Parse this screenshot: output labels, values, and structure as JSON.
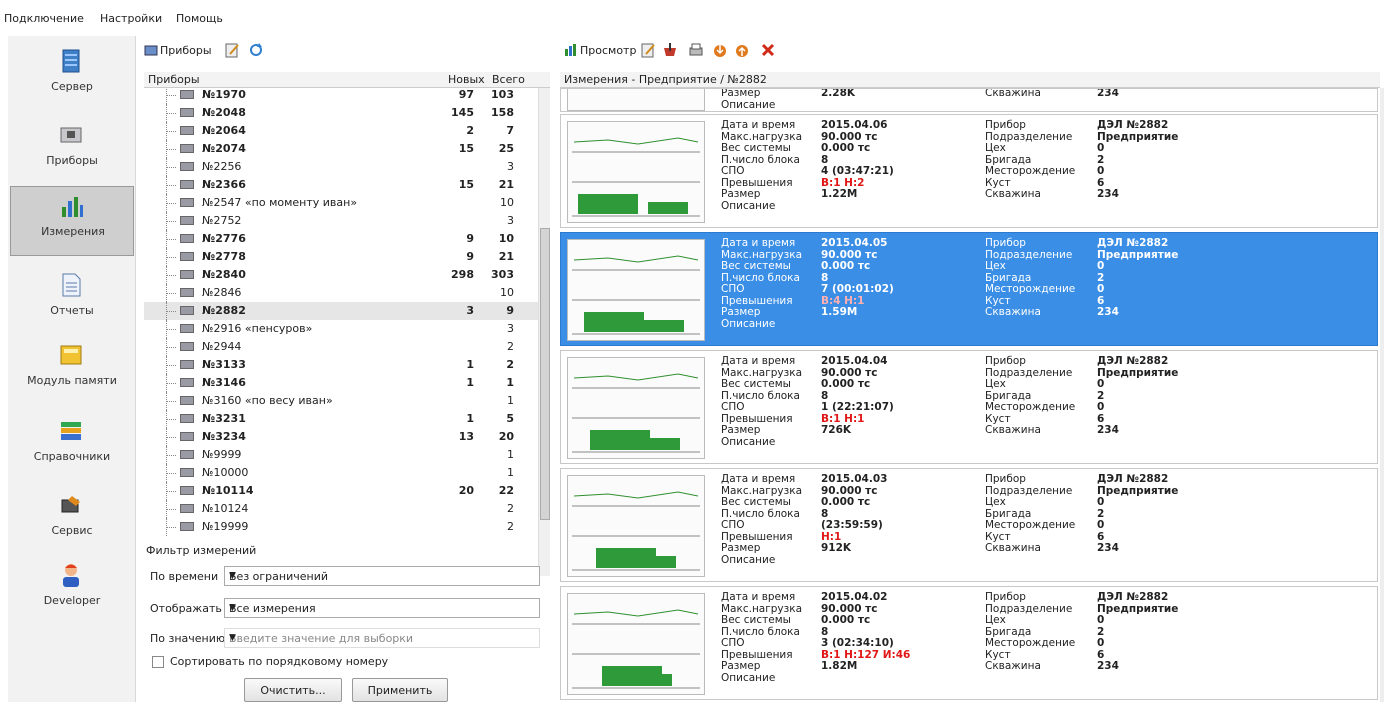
{
  "menu": [
    "Подключение",
    "Настройки",
    "Помощь"
  ],
  "nav": [
    {
      "label": "Сервер",
      "icon": "server-icon"
    },
    {
      "label": "Приборы",
      "icon": "devices-icon"
    },
    {
      "label": "Измерения",
      "icon": "chart-icon"
    },
    {
      "label": "Отчеты",
      "icon": "report-icon"
    },
    {
      "label": "Модуль памяти",
      "icon": "memory-module-icon"
    },
    {
      "label": "Справочники",
      "icon": "books-icon"
    },
    {
      "label": "Сервис",
      "icon": "service-icon"
    },
    {
      "label": "Developer",
      "icon": "developer-icon"
    }
  ],
  "devices": {
    "toolbar_label": "Приборы",
    "col_name": "Приборы",
    "col_new": "Новых",
    "col_total": "Всего",
    "rows": [
      {
        "name": "№1970",
        "new": "97",
        "total": "103",
        "bold": true
      },
      {
        "name": "№2048",
        "new": "145",
        "total": "158",
        "bold": true
      },
      {
        "name": "№2064",
        "new": "2",
        "total": "7",
        "bold": true
      },
      {
        "name": "№2074",
        "new": "15",
        "total": "25",
        "bold": true
      },
      {
        "name": "№2256",
        "new": "",
        "total": "3",
        "bold": false
      },
      {
        "name": "№2366",
        "new": "15",
        "total": "21",
        "bold": true
      },
      {
        "name": "№2547 «по моменту иван»",
        "new": "",
        "total": "10",
        "bold": false
      },
      {
        "name": "№2752",
        "new": "",
        "total": "3",
        "bold": false
      },
      {
        "name": "№2776",
        "new": "9",
        "total": "10",
        "bold": true
      },
      {
        "name": "№2778",
        "new": "9",
        "total": "21",
        "bold": true
      },
      {
        "name": "№2840",
        "new": "298",
        "total": "303",
        "bold": true
      },
      {
        "name": "№2846",
        "new": "",
        "total": "10",
        "bold": false
      },
      {
        "name": "№2882",
        "new": "3",
        "total": "9",
        "bold": true
      },
      {
        "name": "№2916 «пенсуров»",
        "new": "",
        "total": "3",
        "bold": false
      },
      {
        "name": "№2944",
        "new": "",
        "total": "2",
        "bold": false
      },
      {
        "name": "№3133",
        "new": "1",
        "total": "2",
        "bold": true
      },
      {
        "name": "№3146",
        "new": "1",
        "total": "1",
        "bold": true
      },
      {
        "name": "№3160 «по весу иван»",
        "new": "",
        "total": "1",
        "bold": false
      },
      {
        "name": "№3231",
        "new": "1",
        "total": "5",
        "bold": true
      },
      {
        "name": "№3234",
        "new": "13",
        "total": "20",
        "bold": true
      },
      {
        "name": "№9999",
        "new": "",
        "total": "1",
        "bold": false
      },
      {
        "name": "№10000",
        "new": "",
        "total": "1",
        "bold": false
      },
      {
        "name": "№10114",
        "new": "20",
        "total": "22",
        "bold": true
      },
      {
        "name": "№10124",
        "new": "",
        "total": "2",
        "bold": false
      },
      {
        "name": "№19999",
        "new": "",
        "total": "2",
        "bold": false
      }
    ]
  },
  "filter": {
    "title": "Фильтр измерений",
    "time_label": "По времени",
    "time_value": "Без ограничений",
    "show_label": "Отображать",
    "show_value": "Все измерения",
    "value_label": "По значению",
    "value_placeholder": "Введите значение для выборки",
    "sort_label": "Сортировать по порядковому номеру",
    "clear_button": "Очистить...",
    "apply_button": "Применить"
  },
  "measurements": {
    "toolbar_label": "Просмотр",
    "header": "Измерения - Предприятие / №2882",
    "partial": {
      "f1": "Размер",
      "v1": "2.28K",
      "f2": "Скважина",
      "v2": "234",
      "f3": "Описание"
    },
    "labels_left": [
      "Дата и время",
      "Макс.нагрузка",
      "Вес системы",
      "П.число блока",
      "СПО",
      "Превышения",
      "Размер",
      "Описание"
    ],
    "labels_right": [
      "Прибор",
      "Подразделение",
      "Цех",
      "Бригада",
      "Месторождение",
      "Куст",
      "Скважина"
    ],
    "cards": [
      {
        "date": "2015.04.06",
        "load": "90.000 тс",
        "weight": "0.000 тс",
        "blocks": "8",
        "spo": "4 (03:47:21)",
        "exceed": "В:1 Н:2",
        "size": "1.22M",
        "device": "ДЭЛ №2882",
        "division": "Предприятие",
        "shop": "0",
        "brigade": "2",
        "field": "0",
        "cluster": "6",
        "well": "234"
      },
      {
        "date": "2015.04.05",
        "load": "90.000 тс",
        "weight": "0.000 тс",
        "blocks": "8",
        "spo": "7 (00:01:02)",
        "exceed": "В:4 Н:1",
        "size": "1.59M",
        "device": "ДЭЛ №2882",
        "division": "Предприятие",
        "shop": "0",
        "brigade": "2",
        "field": "0",
        "cluster": "6",
        "well": "234"
      },
      {
        "date": "2015.04.04",
        "load": "90.000 тс",
        "weight": "0.000 тс",
        "blocks": "8",
        "spo": "1 (22:21:07)",
        "exceed": "В:1 Н:1",
        "size": "726K",
        "device": "ДЭЛ №2882",
        "division": "Предприятие",
        "shop": "0",
        "brigade": "2",
        "field": "0",
        "cluster": "6",
        "well": "234"
      },
      {
        "date": "2015.04.03",
        "load": "90.000 тс",
        "weight": "0.000 тс",
        "blocks": "8",
        "spo": "(23:59:59)",
        "exceed": "Н:1",
        "size": "912K",
        "device": "ДЭЛ №2882",
        "division": "Предприятие",
        "shop": "0",
        "brigade": "2",
        "field": "0",
        "cluster": "6",
        "well": "234"
      },
      {
        "date": "2015.04.02",
        "load": "90.000 тс",
        "weight": "0.000 тс",
        "blocks": "8",
        "spo": "3 (02:34:10)",
        "exceed": "В:1 Н:127 И:46",
        "size": "1.82M",
        "device": "ДЭЛ №2882",
        "division": "Предприятие",
        "shop": "0",
        "brigade": "2",
        "field": "0",
        "cluster": "6",
        "well": "234"
      }
    ]
  }
}
